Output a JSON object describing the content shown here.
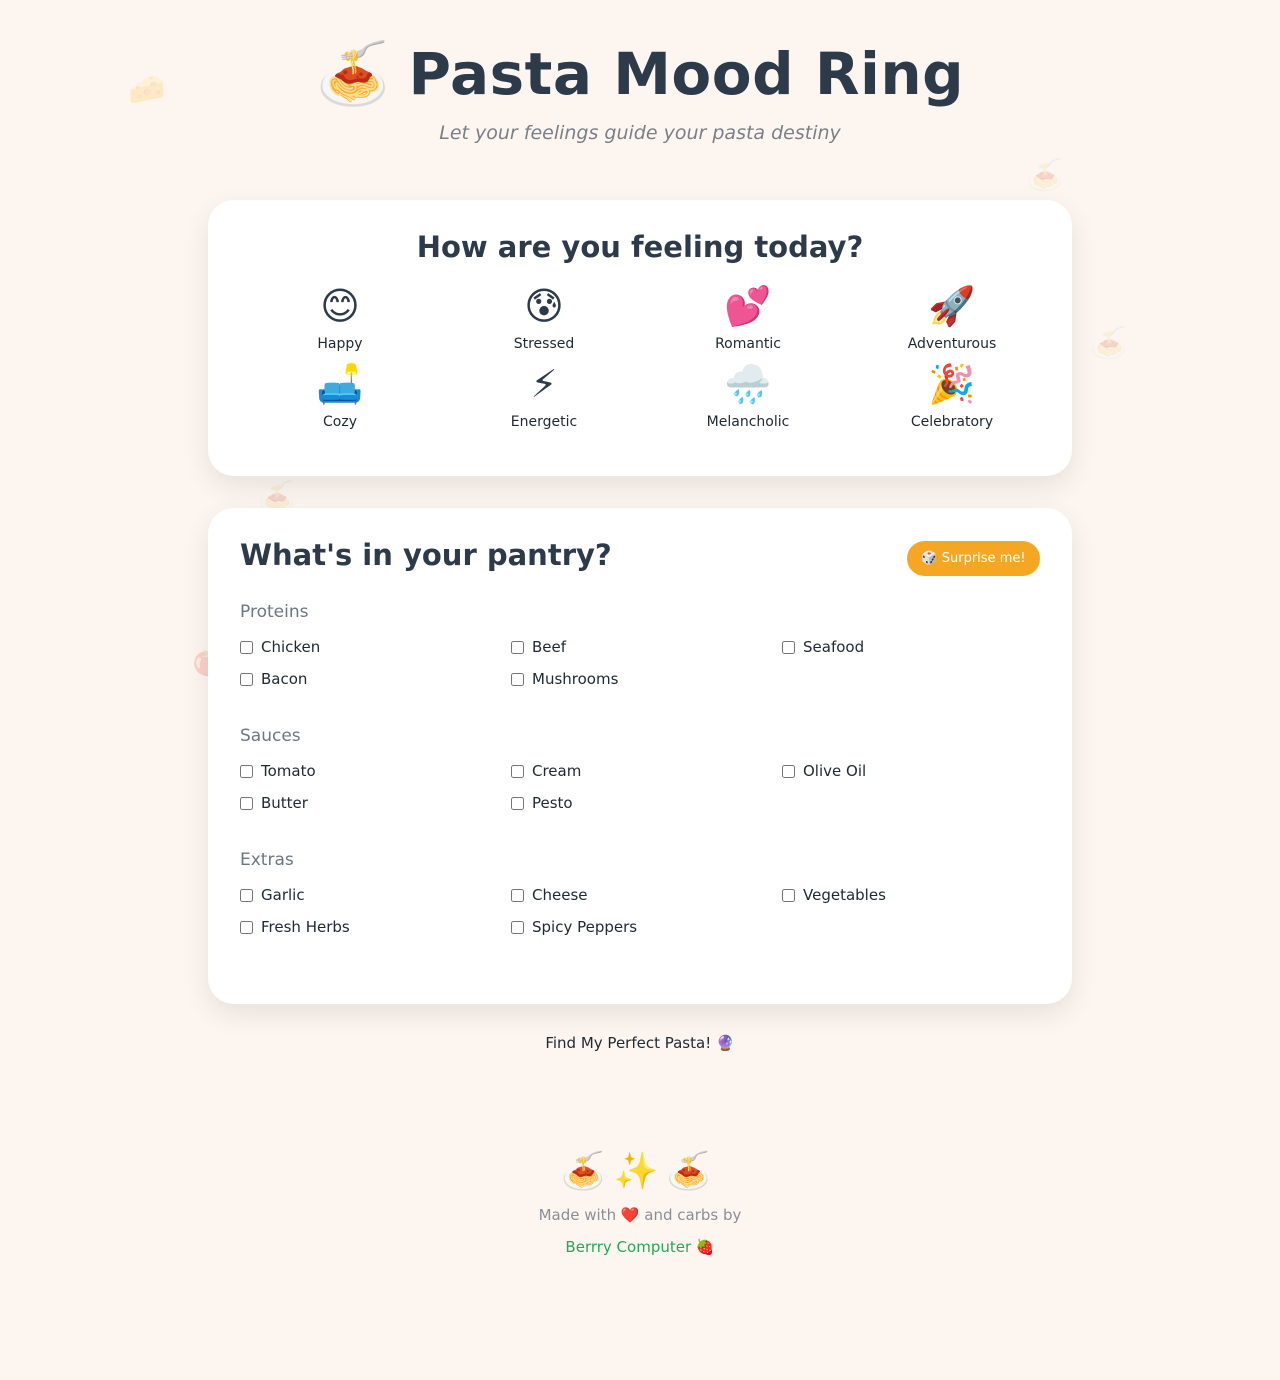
{
  "header": {
    "icon": "🍝",
    "title": "Pasta Mood Ring",
    "subtitle": "Let your feelings guide your pasta destiny"
  },
  "mood": {
    "heading": "How are you feeling today?",
    "items": [
      {
        "emoji": "😊",
        "label": "Happy"
      },
      {
        "emoji": "😰",
        "label": "Stressed"
      },
      {
        "emoji": "💕",
        "label": "Romantic"
      },
      {
        "emoji": "🚀",
        "label": "Adventurous"
      },
      {
        "emoji": "🛋️",
        "label": "Cozy"
      },
      {
        "emoji": "⚡",
        "label": "Energetic"
      },
      {
        "emoji": "🌧️",
        "label": "Melancholic"
      },
      {
        "emoji": "🎉",
        "label": "Celebratory"
      }
    ]
  },
  "pantry": {
    "heading": "What's in your pantry?",
    "surprise_label": "🎲 Surprise me!",
    "sections": [
      {
        "title": "Proteins",
        "items": [
          "Chicken",
          "Beef",
          "Seafood",
          "Bacon",
          "Mushrooms"
        ]
      },
      {
        "title": "Sauces",
        "items": [
          "Tomato",
          "Cream",
          "Olive Oil",
          "Butter",
          "Pesto"
        ]
      },
      {
        "title": "Extras",
        "items": [
          "Garlic",
          "Cheese",
          "Vegetables",
          "Fresh Herbs",
          "Spicy Peppers"
        ]
      }
    ]
  },
  "find_button": "Find My Perfect Pasta! 🔮",
  "footer": {
    "emoji_row": "🍝✨🍝",
    "made_with": "Made with ❤️ and carbs by",
    "credit": "Berrry Computer 🍓"
  },
  "colors": {
    "background": "#fdf6f0",
    "accent": "#f5a623",
    "link": "#26a65b",
    "heading": "#2d3a4a"
  }
}
